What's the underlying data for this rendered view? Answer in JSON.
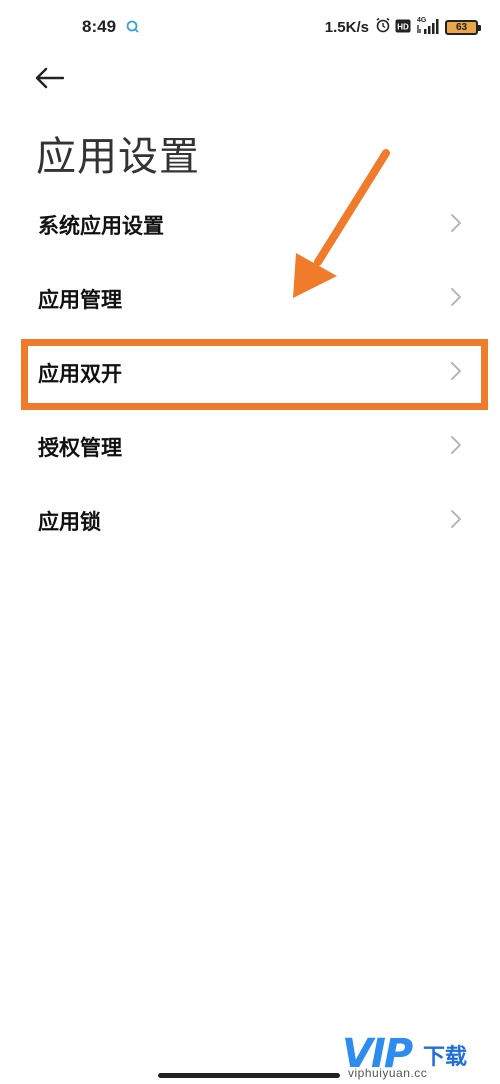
{
  "status_bar": {
    "time": "8:49",
    "net_speed": "1.5K/s",
    "hd_badge": "HD",
    "network_type": "4G",
    "battery_level": "63",
    "icons": [
      "notification-icon",
      "alarm-icon",
      "hd-icon",
      "signal-icon",
      "battery-icon"
    ]
  },
  "header": {
    "back_icon": "back-arrow-icon",
    "title": "应用设置"
  },
  "settings": {
    "items": [
      {
        "label": "系统应用设置"
      },
      {
        "label": "应用管理"
      },
      {
        "label": "应用双开",
        "highlighted": true
      },
      {
        "label": "授权管理"
      },
      {
        "label": "应用锁"
      }
    ],
    "chevron_icon": "chevron-right-icon"
  },
  "annotation": {
    "highlight_color": "#f07b2a",
    "arrow_color": "#f07b2a"
  },
  "watermark": {
    "brand": "VIP",
    "suffix": "下载",
    "url": "viphuiyuan.cc",
    "color": "#2d8cf0"
  }
}
